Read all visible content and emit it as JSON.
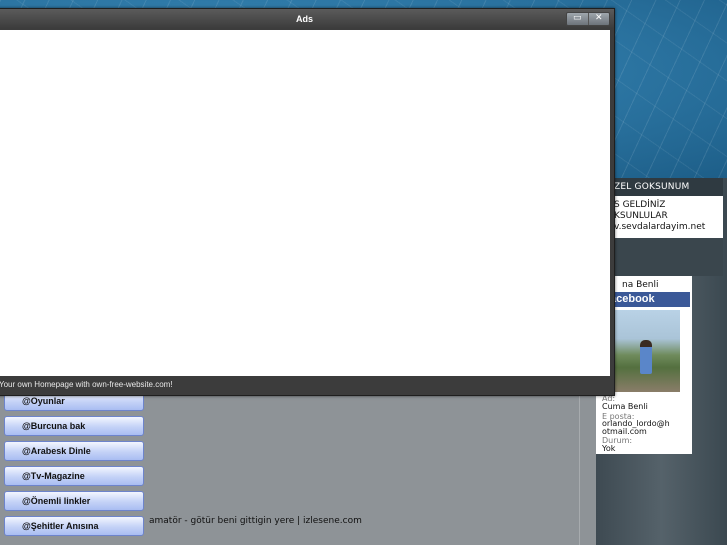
{
  "ads_window": {
    "title": "Ads",
    "footer": "Your own Homepage with own-free-website.com!",
    "restore_glyph": "▭",
    "close_glyph": "✕"
  },
  "sidebar_widget": {
    "header": "ZEL GOKSUNUM",
    "lines": [
      "S GELDİNİZ",
      "KSUNLULAR",
      "v.sevdalardayim.net"
    ]
  },
  "facebook_card": {
    "name": "na Benli",
    "brand": "acebook",
    "fields": [
      {
        "label": "Ad:",
        "value": "Cuma Benli"
      },
      {
        "label": "E posta:",
        "value": "orlando_lordo@h"
      },
      {
        "label": "",
        "value": "otmail.com"
      },
      {
        "label": "Durum:",
        "value": "Yok"
      }
    ]
  },
  "nav_menu": {
    "items": [
      {
        "label": "@Oyunlar"
      },
      {
        "label": "@Burcuna bak"
      },
      {
        "label": "@Arabesk Dinle"
      },
      {
        "label": "@Tv-Magazine"
      },
      {
        "label": "@Önemli linkler"
      },
      {
        "label": "@Şehitler Anısına"
      }
    ]
  },
  "main": {
    "footer_text": "amatör - götür beni gittigin yere | izlesene.com"
  },
  "colors": {
    "facebook_blue": "#3b5998",
    "nav_button_top": "#f3f6ff",
    "nav_button_bottom": "#a9bdf2"
  }
}
